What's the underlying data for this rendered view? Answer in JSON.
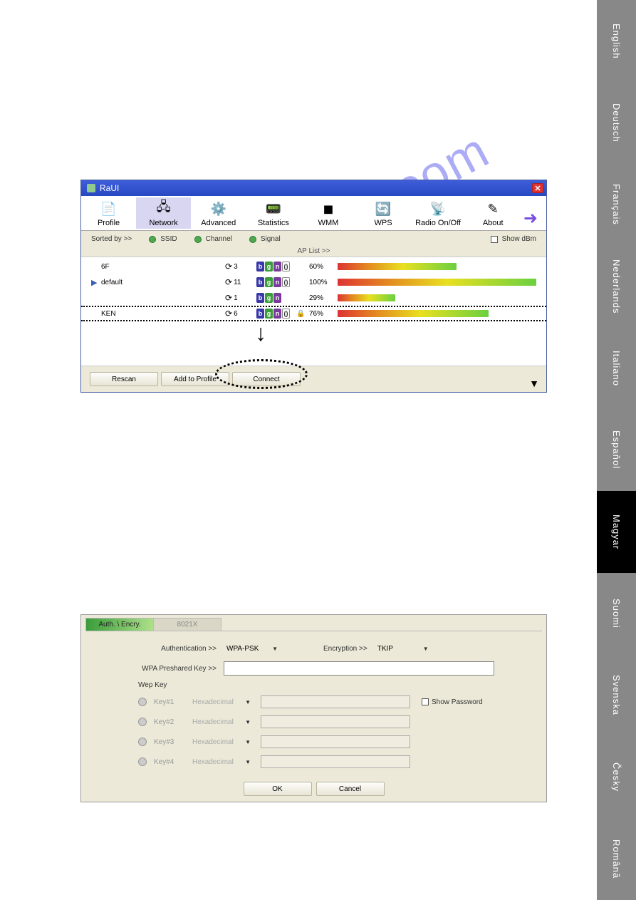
{
  "raui": {
    "title": "RaUI",
    "toolbar": [
      {
        "label": "Profile",
        "icon": "📄"
      },
      {
        "label": "Network",
        "icon": "🖧",
        "active": true
      },
      {
        "label": "Advanced",
        "icon": "⚙️"
      },
      {
        "label": "Statistics",
        "icon": "📟"
      },
      {
        "label": "WMM",
        "icon": "◼"
      },
      {
        "label": "WPS",
        "icon": "🔄"
      },
      {
        "label": "Radio On/Off",
        "icon": "📡"
      },
      {
        "label": "About",
        "icon": "✎"
      }
    ],
    "sort_label": "Sorted by >>",
    "sort_opts": [
      "SSID",
      "Channel",
      "Signal"
    ],
    "show_dbm": "Show dBm",
    "ap_list_label": "AP List >>",
    "rows": [
      {
        "sel": "",
        "name": "6F",
        "ch": "3",
        "modes": [
          "b",
          "g",
          "n",
          "s"
        ],
        "lock": "",
        "pct": "60%",
        "sig": 60
      },
      {
        "sel": "▶",
        "name": "default",
        "ch": "11",
        "modes": [
          "b",
          "g",
          "n",
          "s"
        ],
        "lock": "",
        "pct": "100%",
        "sig": 100
      },
      {
        "sel": "",
        "name": "",
        "ch": "1",
        "modes": [
          "b",
          "g",
          "n"
        ],
        "lock": "",
        "pct": "29%",
        "sig": 29
      },
      {
        "sel": "",
        "name": "KEN",
        "ch": "6",
        "modes": [
          "b",
          "g",
          "n",
          "s"
        ],
        "lock": "🔒",
        "pct": "76%",
        "sig": 76,
        "ken": true
      }
    ],
    "btns": {
      "rescan": "Rescan",
      "add": "Add to Profile",
      "connect": "Connect"
    }
  },
  "auth": {
    "tabs": {
      "auth": "Auth. \\ Encry.",
      "dot1x": "8021X"
    },
    "auth_lbl": "Authentication >>",
    "auth_val": "WPA-PSK",
    "enc_lbl": "Encryption >>",
    "enc_val": "TKIP",
    "psk_lbl": "WPA Preshared Key >>",
    "wep_lbl": "Wep Key",
    "keys": [
      {
        "lbl": "Key#1",
        "fmt": "Hexadecimal"
      },
      {
        "lbl": "Key#2",
        "fmt": "Hexadecimal"
      },
      {
        "lbl": "Key#3",
        "fmt": "Hexadecimal"
      },
      {
        "lbl": "Key#4",
        "fmt": "Hexadecimal"
      }
    ],
    "showpw": "Show Password",
    "ok": "OK",
    "cancel": "Cancel"
  },
  "langs": [
    "English",
    "Deutsch",
    "Français",
    "Nederlands",
    "Italiano",
    "Espaňol",
    "Magyar",
    "Suomi",
    "Svenska",
    "Česky",
    "Română"
  ],
  "active_lang": "Magyar",
  "watermark": "manualshive.com"
}
